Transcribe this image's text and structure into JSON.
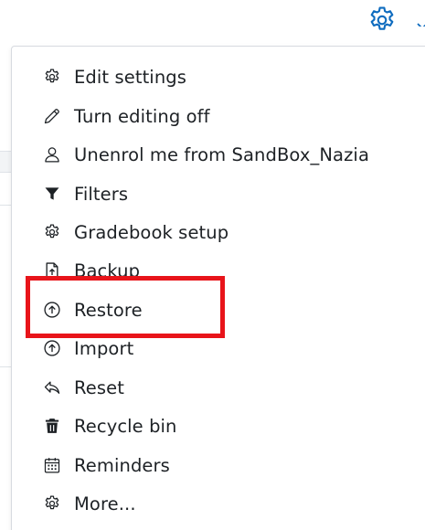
{
  "colors": {
    "accent": "#0f6cbf",
    "text": "#1d2125",
    "highlight": "#e8141a",
    "border": "#d7dbe0"
  },
  "trigger": {
    "icon": "gear-icon"
  },
  "menu": {
    "items": [
      {
        "label": "Edit settings",
        "icon": "gear-icon"
      },
      {
        "label": "Turn editing off",
        "icon": "pencil-icon"
      },
      {
        "label": "Unenrol me from SandBox_Nazia",
        "icon": "user-icon"
      },
      {
        "label": "Filters",
        "icon": "filter-icon"
      },
      {
        "label": "Gradebook setup",
        "icon": "gear-icon"
      },
      {
        "label": "Backup",
        "icon": "file-upload-icon"
      },
      {
        "label": "Restore",
        "icon": "circle-arrow-up-icon"
      },
      {
        "label": "Import",
        "icon": "circle-arrow-up-icon"
      },
      {
        "label": "Reset",
        "icon": "reply-icon"
      },
      {
        "label": "Recycle bin",
        "icon": "trash-icon"
      },
      {
        "label": "Reminders",
        "icon": "calendar-icon"
      },
      {
        "label": "More...",
        "icon": "gear-icon"
      }
    ]
  }
}
